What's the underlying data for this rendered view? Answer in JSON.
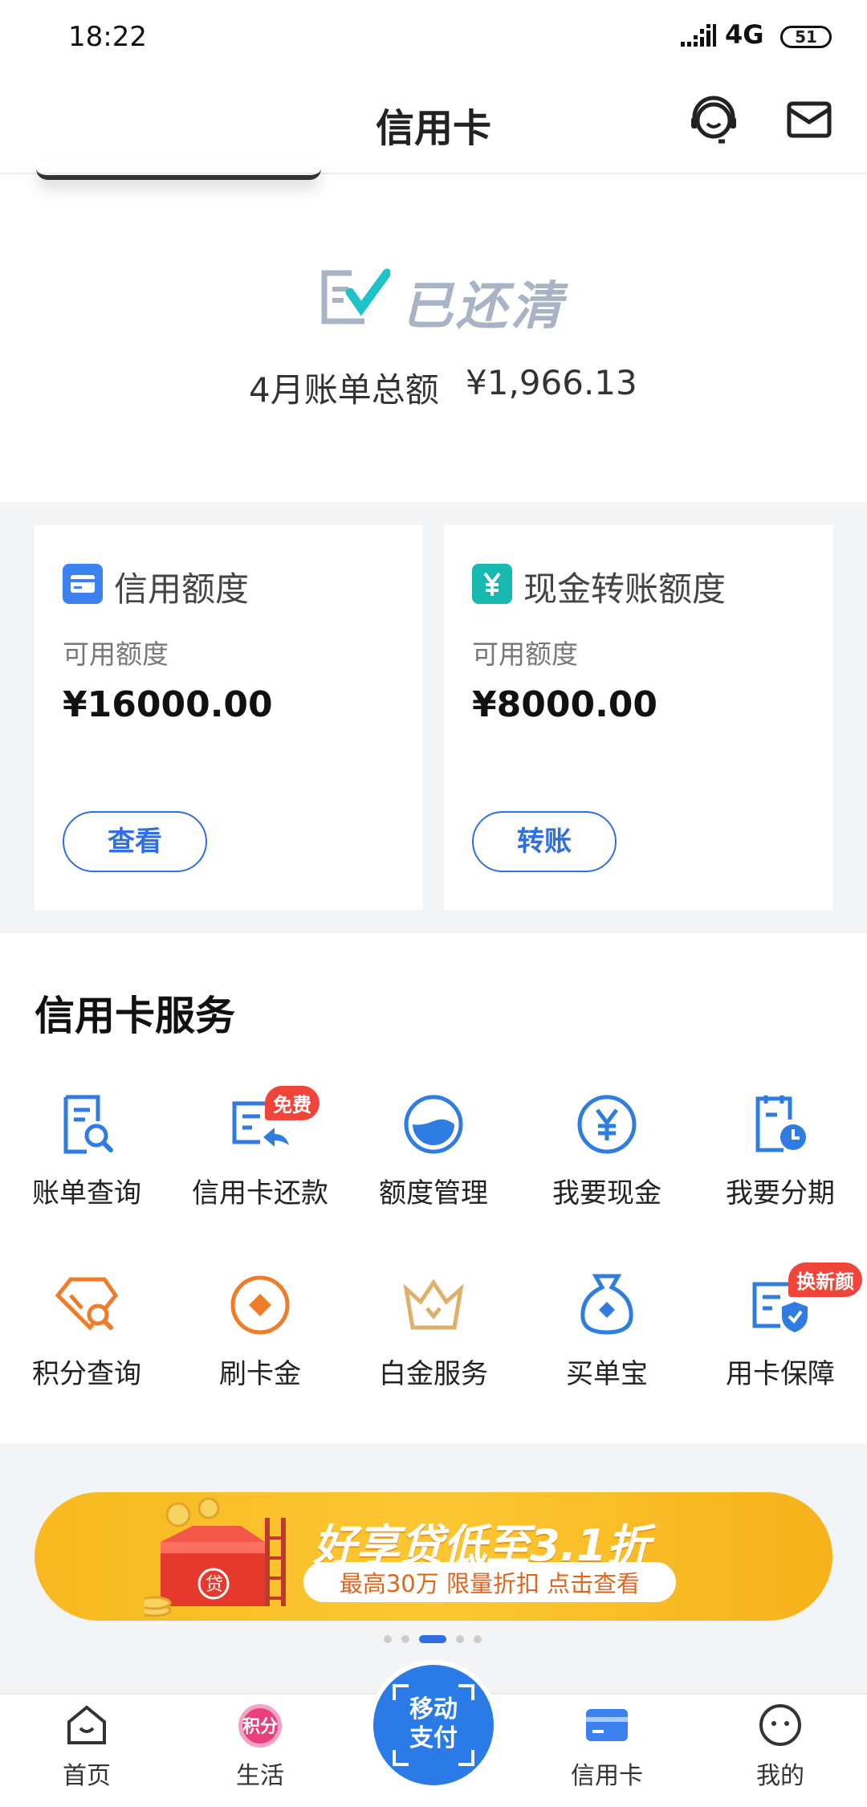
{
  "status_bar": {
    "time": "18:22",
    "network": "4G",
    "battery": "51"
  },
  "header": {
    "title": "信用卡"
  },
  "bill": {
    "status": "已还清",
    "label": "4月账单总额",
    "amount": "¥1,966.13"
  },
  "limits": [
    {
      "title": "信用额度",
      "sub": "可用额度",
      "value": "¥16000.00",
      "button": "查看",
      "icon_color": "#3b82f0",
      "icon": "card-icon"
    },
    {
      "title": "现金转账额度",
      "sub": "可用额度",
      "value": "¥8000.00",
      "button": "转账",
      "icon_color": "#16b8b0",
      "icon": "yuan-icon"
    }
  ],
  "services": {
    "heading": "信用卡服务",
    "items": [
      {
        "label": "账单查询",
        "icon": "bill-search-icon"
      },
      {
        "label": "信用卡还款",
        "icon": "repay-icon",
        "badge": "免费"
      },
      {
        "label": "额度管理",
        "icon": "limit-gauge-icon"
      },
      {
        "label": "我要现金",
        "icon": "yuan-circle-icon"
      },
      {
        "label": "我要分期",
        "icon": "installment-icon"
      },
      {
        "label": "积分查询",
        "icon": "points-search-icon"
      },
      {
        "label": "刷卡金",
        "icon": "coin-icon"
      },
      {
        "label": "白金服务",
        "icon": "crown-icon"
      },
      {
        "label": "买单宝",
        "icon": "money-bag-icon"
      },
      {
        "label": "用卡保障",
        "icon": "card-shield-icon",
        "badge": "换新颜"
      }
    ]
  },
  "banner": {
    "title": "好享贷低至3.1折",
    "subtitle": "最高30万 限量折扣 点击查看",
    "box_char": "贷"
  },
  "carousel": {
    "count": 5,
    "active": 2
  },
  "bottom_nav": {
    "items": [
      {
        "label": "首页",
        "icon": "home-icon"
      },
      {
        "label": "生活",
        "icon": "points-badge-icon",
        "badge_text": "积分"
      },
      {
        "label": "信用卡",
        "icon": "credit-card-icon"
      },
      {
        "label": "我的",
        "icon": "profile-icon"
      }
    ],
    "pay": "移动\n支付"
  },
  "colors": {
    "accent": "#2f6fe0",
    "orange": "#f07b28",
    "gold": "#f7b91f"
  }
}
